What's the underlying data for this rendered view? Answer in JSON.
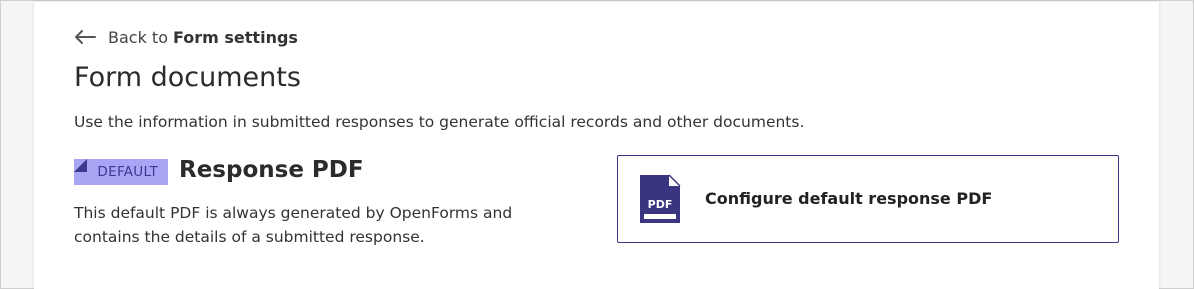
{
  "back_link": {
    "prefix": "Back to",
    "target": "Form settings"
  },
  "page": {
    "title": "Form documents",
    "description": "Use the information in submitted responses to generate official records and other documents."
  },
  "response_pdf": {
    "badge": "DEFAULT",
    "heading": "Response PDF",
    "description": "This default PDF is always generated by OpenForms and contains the details of a submitted response."
  },
  "configure_card": {
    "icon_text": "PDF",
    "label": "Configure default response PDF"
  },
  "colors": {
    "accent": "#3a3580",
    "badge_bg": "#a9a5f5",
    "badge_text": "#3e3890"
  }
}
